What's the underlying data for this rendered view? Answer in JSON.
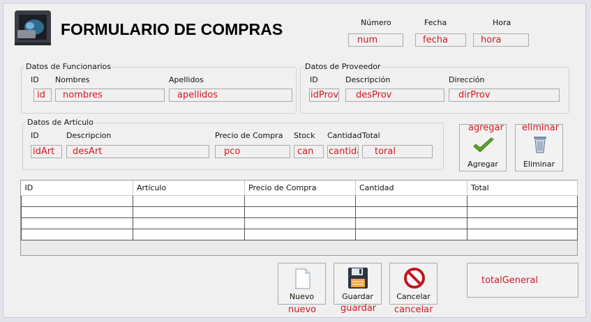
{
  "header": {
    "title": "FORMULARIO DE COMPRAS",
    "numero_label": "Número",
    "fecha_label": "Fecha",
    "hora_label": "Hora",
    "numero_value": "num",
    "fecha_value": "fecha",
    "hora_value": "hora"
  },
  "funcionarios": {
    "legend": "Datos de Funcionarios",
    "id_label": "ID",
    "nombres_label": "Nombres",
    "apellidos_label": "Apellidos",
    "id_value": "id",
    "nombres_value": "nombres",
    "apellidos_value": "apellidos"
  },
  "proveedor": {
    "legend": "Datos de Proveedor",
    "id_label": "ID",
    "descripcion_label": "Descripción",
    "direccion_label": "Dirección",
    "id_value": "idProv",
    "descripcion_value": "desProv",
    "direccion_value": "dirProv"
  },
  "articulo": {
    "legend": "Datos de Articulo",
    "id_label": "ID",
    "descripcion_label": "Descripcion",
    "precio_label": "Precio de Compra",
    "stock_label": "Stock",
    "cantidad_label": "Cantidad",
    "total_label": "Total",
    "id_value": "idArt",
    "descripcion_value": "desArt",
    "precio_value": "pco",
    "stock_value": "can",
    "cantidad_value": "cantidad",
    "total_value": "toral"
  },
  "actions": {
    "agregar_label": "Agregar",
    "agregar_name": "agregar",
    "eliminar_label": "Eliminar",
    "eliminar_name": "eliminar"
  },
  "table": {
    "columns": [
      "ID",
      "Artículo",
      "Precio de Compra",
      "Cantidad",
      "Total"
    ],
    "rows": [
      [
        "",
        "",
        "",
        "",
        ""
      ],
      [
        "",
        "",
        "",
        "",
        ""
      ],
      [
        "",
        "",
        "",
        "",
        ""
      ],
      [
        "",
        "",
        "",
        "",
        ""
      ]
    ]
  },
  "footer": {
    "nuevo_label": "Nuevo",
    "nuevo_name": "nuevo",
    "guardar_label": "Guardar",
    "guardar_name": "guardar",
    "cancelar_label": "Cancelar",
    "cancelar_name": "cancelar",
    "total_general": "totalGeneral"
  },
  "icons": {
    "logo": "monitor-logo-icon",
    "agregar": "checkmark-icon",
    "eliminar": "trash-icon",
    "nuevo": "new-document-icon",
    "guardar": "floppy-disk-icon",
    "cancelar": "cancel-icon"
  },
  "colors": {
    "accent_red": "#d3161f",
    "check_green": "#5aa52a"
  }
}
